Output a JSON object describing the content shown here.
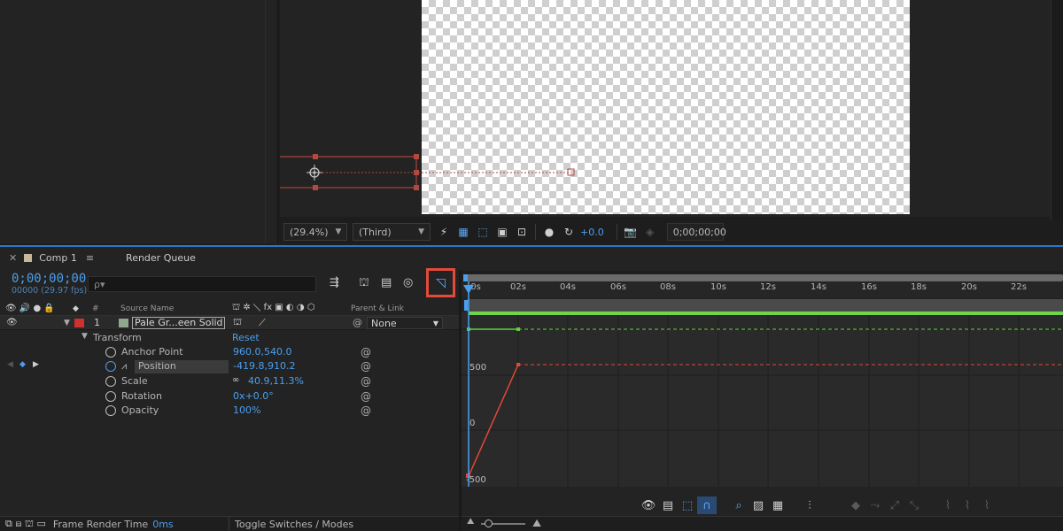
{
  "viewer": {
    "zoom": "(29.4%)",
    "resolution": "(Third)",
    "exposure": "+0.0",
    "timecode": "0;00;00;00"
  },
  "tabs": [
    {
      "label": "Comp 1"
    },
    {
      "label": "Render Queue"
    }
  ],
  "timeline": {
    "timecode": "0;00;00;00",
    "timecode_sub": "00000 (29.97 fps)",
    "search_placeholder": "ρ▾"
  },
  "columns": {
    "num": "#",
    "source": "Source Name",
    "parent": "Parent & Link"
  },
  "layer": {
    "number": "1",
    "name": "Pale Gr...een Solid 1",
    "parent_value": "None",
    "label_color": "#d0312d"
  },
  "transform": {
    "label": "Transform",
    "reset": "Reset",
    "props": [
      {
        "name": "Anchor Point",
        "value": "960.0,540.0"
      },
      {
        "name": "Position",
        "value": "-419.8,910.2"
      },
      {
        "name": "Scale",
        "value": "40.9,11.3%"
      },
      {
        "name": "Rotation",
        "value": "0x+0.0°"
      },
      {
        "name": "Opacity",
        "value": "100%"
      }
    ]
  },
  "bottom": {
    "frame_render_label": "Frame Render Time",
    "frame_render_value": "0ms",
    "toggle_label": "Toggle Switches / Modes"
  },
  "ruler_ticks": [
    "0s",
    "02s",
    "04s",
    "06s",
    "08s",
    "10s",
    "12s",
    "14s",
    "16s",
    "18s",
    "20s",
    "22s"
  ],
  "graph_y_labels": [
    "500",
    "0",
    "-500"
  ],
  "colors": {
    "accent_blue": "#4a9fee",
    "highlight_red": "#e24a3a",
    "curve_red": "#e0483a",
    "curve_green": "#5ed13c"
  }
}
